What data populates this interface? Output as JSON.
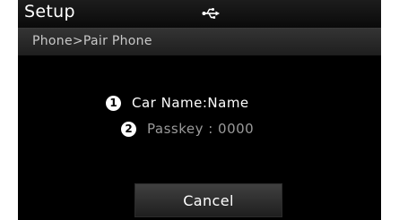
{
  "header": {
    "title": "Setup",
    "status_icon": "usb-icon"
  },
  "breadcrumb": "Phone>Pair Phone",
  "pairing": {
    "items": [
      {
        "number": "1",
        "text": "Car Name:Name"
      },
      {
        "number": "2",
        "text": "Passkey : 0000"
      }
    ]
  },
  "actions": {
    "cancel_label": "Cancel"
  },
  "colors": {
    "background": "#000000",
    "primary_text": "#ffffff",
    "secondary_text": "#9a9a9a",
    "breadcrumb_text": "#c8c8c8"
  }
}
